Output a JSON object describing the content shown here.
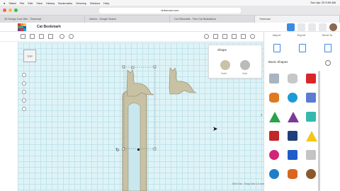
{
  "menubar": {
    "items": [
      "Safari",
      "File",
      "Edit",
      "View",
      "History",
      "Bookmarks",
      "Develop",
      "Window",
      "Help"
    ],
    "clock": "Sun Apr 23  9:59 AM"
  },
  "browser": {
    "url": "tinkercad.com",
    "tabs": [
      "3D Design Cool Vibe - Tinkercad",
      "Interior - Google Search",
      "Cat Silhouette - Free Cat Illustrations",
      "Tinkercad"
    ]
  },
  "app": {
    "title": "Cat Bookmark",
    "logo_colors": [
      "#e1372a",
      "#f28c28",
      "#f4c431",
      "#43b04a",
      "#00a3e0",
      "#1d5fa8",
      "#6f3f98",
      "#e1372a",
      "#00a3e0"
    ],
    "top_right_actions": [
      "grid-view",
      "build",
      "learn",
      "collaborate",
      "user"
    ],
    "user_link": "All changes saved"
  },
  "workplane": {
    "viewcube_label": "TOP"
  },
  "shape_panel": {
    "title": "Shape",
    "swatches": [
      {
        "label": "Solid",
        "color": "#c9c2a8"
      },
      {
        "label": "Hole",
        "color": "#bbbbbb"
      }
    ]
  },
  "library": {
    "tabs": [
      "Import",
      "Export",
      "Send To"
    ],
    "category": "Basic Shapes",
    "shapes": [
      {
        "name": "box-grey",
        "color": "#a8b4bf"
      },
      {
        "name": "cylinder-grey",
        "color": "#c7c7c7"
      },
      {
        "name": "box-red",
        "color": "#d8262b"
      },
      {
        "name": "cylinder-orange",
        "color": "#e07a1f"
      },
      {
        "name": "sphere-blue",
        "color": "#1d9bd8"
      },
      {
        "name": "scribble",
        "color": "#5a7bd4"
      },
      {
        "name": "roof-green",
        "color": "#2aa14a"
      },
      {
        "name": "cone-purple",
        "color": "#7a3a98"
      },
      {
        "name": "round-roof-teal",
        "color": "#35b8b0"
      },
      {
        "name": "text-red",
        "color": "#c22828"
      },
      {
        "name": "wedge-navy",
        "color": "#1e3f7a"
      },
      {
        "name": "pyramid-yellow",
        "color": "#f2c819"
      },
      {
        "name": "sphere-magenta",
        "color": "#d0267a"
      },
      {
        "name": "polygon-blue",
        "color": "#1e5cc8"
      },
      {
        "name": "paraboloid-grey",
        "color": "#c4c4c4"
      },
      {
        "name": "torus-blue",
        "color": "#1d7fc7"
      },
      {
        "name": "tube-orange",
        "color": "#d9661f"
      },
      {
        "name": "ring-brown",
        "color": "#8a5a2a"
      }
    ]
  },
  "status": {
    "edit_grid": "Edit Grid",
    "snap_grid": "Snap Grid 1.0 mm"
  }
}
